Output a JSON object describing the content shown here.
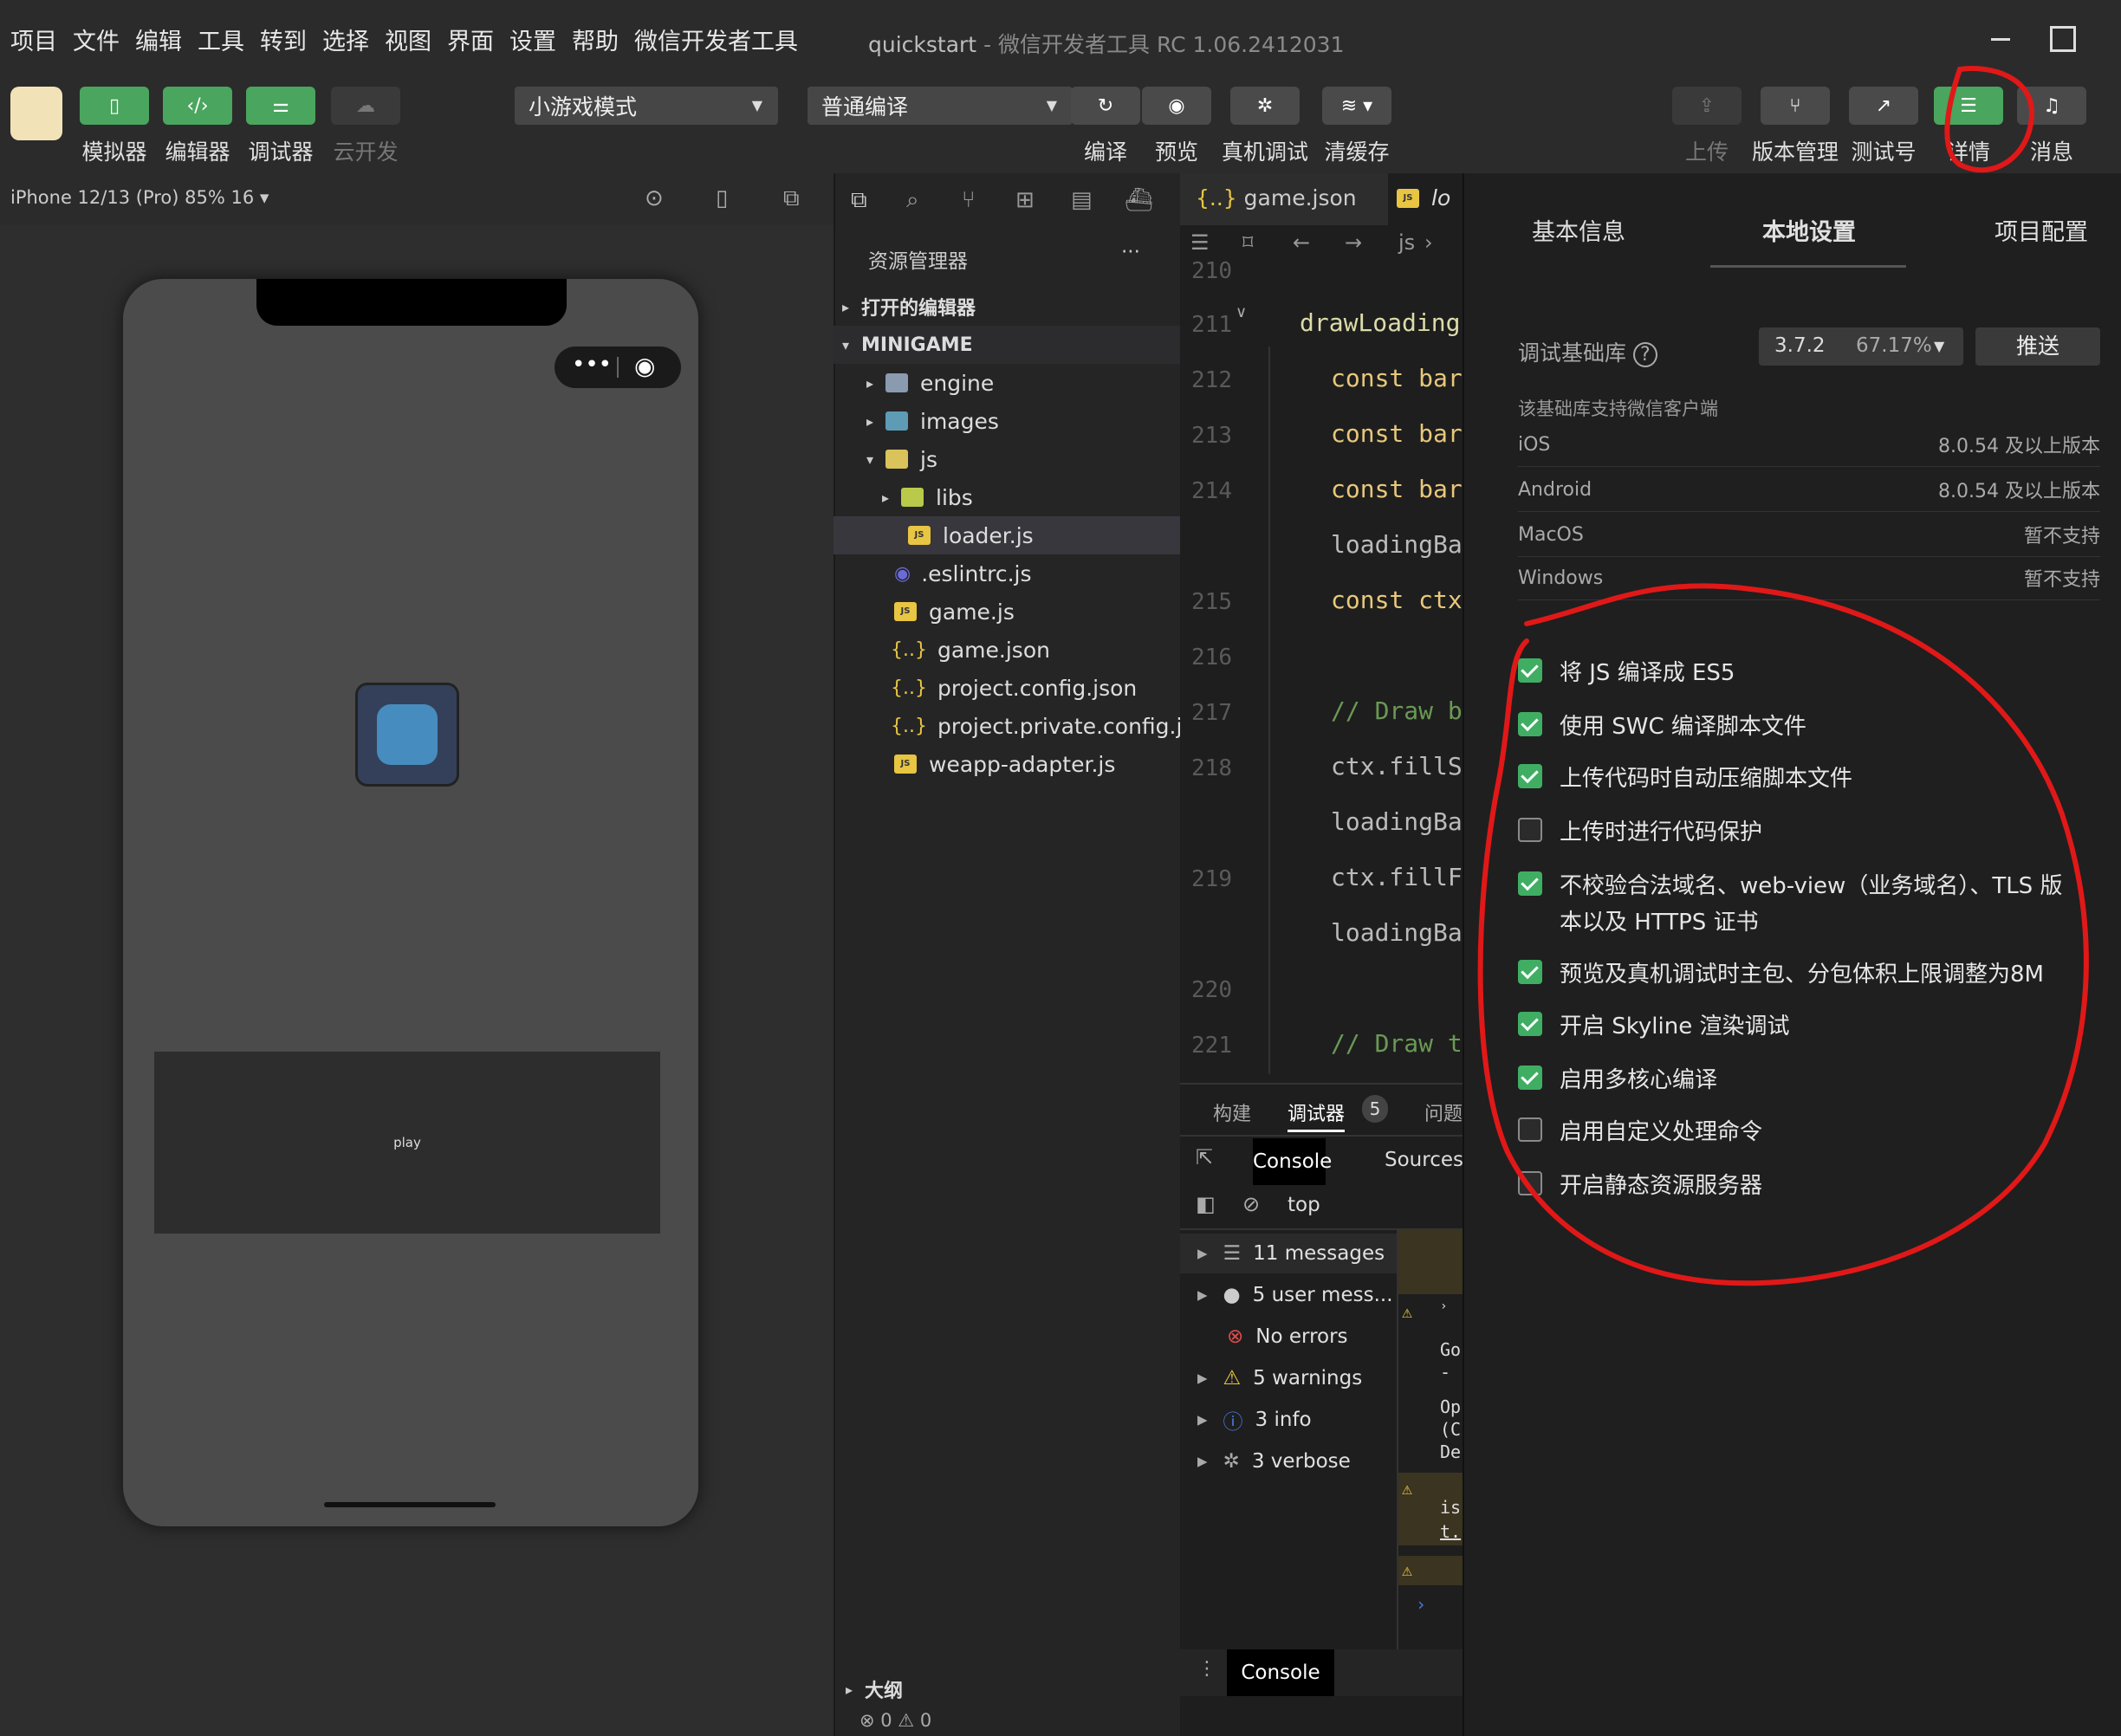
{
  "menubar": {
    "items": [
      "项目",
      "文件",
      "编辑",
      "工具",
      "转到",
      "选择",
      "视图",
      "界面",
      "设置",
      "帮助",
      "微信开发者工具"
    ],
    "title": "quickstart",
    "title_sep": " - ",
    "title_sub": "微信开发者工具 RC 1.06.2412031"
  },
  "toolbar": {
    "simulator": "模拟器",
    "editor": "编辑器",
    "debugger": "调试器",
    "cloud": "云开发",
    "mode_select": "小游戏模式",
    "compile_select": "普通编译",
    "compile": "编译",
    "preview": "预览",
    "real_debug": "真机调试",
    "clear_cache": "清缓存",
    "upload": "上传",
    "version": "版本管理",
    "test_account": "测试号",
    "details": "详情",
    "messages": "消息"
  },
  "simulator": {
    "device": "iPhone 12/13 (Pro) 85% 16 ▾",
    "play": "play"
  },
  "explorer": {
    "title": "资源管理器",
    "more": "···",
    "open_editors": "打开的编辑器",
    "root": "MINIGAME",
    "items": [
      "engine",
      "images",
      "js",
      "libs",
      "loader.js",
      ".eslintrc.js",
      "game.js",
      "game.json",
      "project.config.json",
      "project.private.config.js...",
      "weapp-adapter.js"
    ],
    "outline": "大纲",
    "status_errors": "0",
    "status_warnings": "0"
  },
  "editor": {
    "tab1": "game.json",
    "tab2": "lo",
    "breadcrumb": "js",
    "lines": [
      "210",
      "211",
      "212",
      "213",
      "214",
      "215",
      "216",
      "217",
      "218",
      "219",
      "220",
      "221"
    ],
    "code": [
      "drawLoading",
      "const bar",
      "const bar",
      "const bar",
      "loadingBa",
      "const ctx",
      "// Draw b",
      "ctx.fillS",
      "loadingBa",
      "ctx.fillF",
      "loadingBa",
      "// Draw t"
    ]
  },
  "console": {
    "tab_build": "构建",
    "tab_debugger": "调试器",
    "debugger_count": "5",
    "tab_issues": "问题",
    "tab_console": "Console",
    "tab_sources": "Sources",
    "context": "top",
    "rows": [
      "11 messages",
      "5 user mess...",
      "No errors",
      "5 warnings",
      "3 info",
      "3 verbose"
    ],
    "bottom_tab": "Console",
    "side": [
      "Go",
      "-",
      "Op",
      "(C",
      "De",
      "is",
      "t."
    ]
  },
  "rpanel": {
    "tab_basic": "基本信息",
    "tab_local": "本地设置",
    "tab_project": "项目配置",
    "lib_label": "调试基础库",
    "lib_version": "3.7.2",
    "lib_percent": "67.17%",
    "push": "推送",
    "support_note": "该基础库支持微信客户端",
    "platforms": [
      {
        "name": "iOS",
        "value": "8.0.54 及以上版本"
      },
      {
        "name": "Android",
        "value": "8.0.54 及以上版本"
      },
      {
        "name": "MacOS",
        "value": "暂不支持"
      },
      {
        "name": "Windows",
        "value": "暂不支持"
      }
    ],
    "options": [
      {
        "label": "将 JS 编译成 ES5",
        "checked": true
      },
      {
        "label": "使用 SWC 编译脚本文件",
        "checked": true
      },
      {
        "label": "上传代码时自动压缩脚本文件",
        "checked": true
      },
      {
        "label": "上传时进行代码保护",
        "checked": false
      },
      {
        "label": "不校验合法域名、web-view（业务域名）、TLS 版",
        "label2": "本以及 HTTPS 证书",
        "checked": true
      },
      {
        "label": "预览及真机调试时主包、分包体积上限调整为8M",
        "checked": true
      },
      {
        "label": "开启 Skyline 渲染调试",
        "checked": true
      },
      {
        "label": "启用多核心编译",
        "checked": true
      },
      {
        "label": "启用自定义处理命令",
        "checked": false
      },
      {
        "label": "开启静态资源服务器",
        "checked": false
      }
    ]
  },
  "colors": {
    "accent_green": "#4aa55e",
    "annotation_red": "#e01818",
    "checkbox_green": "#3fae63"
  }
}
